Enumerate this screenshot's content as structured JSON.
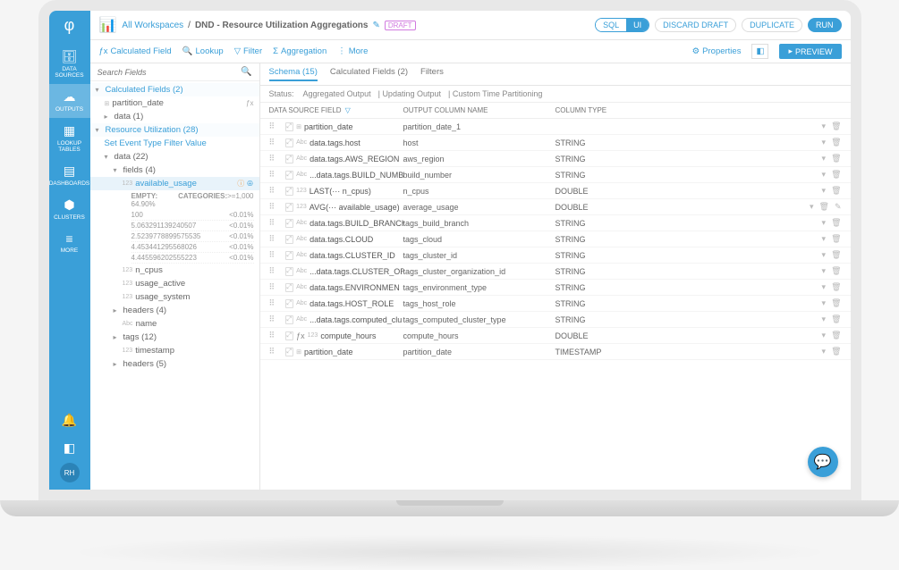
{
  "nav": {
    "items": [
      {
        "icon": "database",
        "label": "DATA SOURCES"
      },
      {
        "icon": "cloud",
        "label": "OUTPUTS",
        "active": true
      },
      {
        "icon": "table",
        "label": "LOOKUP TABLES"
      },
      {
        "icon": "dashboard",
        "label": "DASHBOARDS"
      },
      {
        "icon": "cluster",
        "label": "CLUSTERS"
      },
      {
        "icon": "more",
        "label": "MORE"
      }
    ],
    "avatar": "RH"
  },
  "header": {
    "breadcrumb": [
      "All Workspaces",
      "DND - Resource Utilization Aggregations"
    ],
    "draft": "DRAFT",
    "toggle": {
      "off": "SQL",
      "on": "UI"
    },
    "buttons": {
      "discard": "DISCARD DRAFT",
      "duplicate": "DUPLICATE",
      "run": "RUN"
    }
  },
  "toolbar": {
    "items": [
      {
        "icon": "fx",
        "label": "Calculated Field"
      },
      {
        "icon": "search",
        "label": "Lookup"
      },
      {
        "icon": "funnel",
        "label": "Filter"
      },
      {
        "icon": "sigma",
        "label": "Aggregation"
      },
      {
        "icon": "dots",
        "label": "More"
      }
    ],
    "right": {
      "properties": "Properties",
      "preview": "PREVIEW"
    }
  },
  "search": {
    "placeholder": "Search Fields"
  },
  "tree": {
    "calc_header": "Calculated Fields (2)",
    "calc_item": "partition_date",
    "data_header": "data (1)",
    "ru_header": "Resource Utilization (28)",
    "set_filter": "Set Event Type Filter Value",
    "data22": "data (22)",
    "fields": "fields (4)",
    "selected": "available_usage",
    "stats": {
      "empty_lbl": "EMPTY:",
      "empty": "64.90%",
      "cat_lbl": "CATEGORIES:",
      "cat": ">=1,000"
    },
    "samples": [
      {
        "v": "100",
        "p": "<0.01%"
      },
      {
        "v": "5.063291139240507",
        "p": "<0.01%"
      },
      {
        "v": "2.5239778899575535",
        "p": "<0.01%"
      },
      {
        "v": "4.453441295568026",
        "p": "<0.01%"
      },
      {
        "v": "4.445596202555223",
        "p": "<0.01%"
      }
    ],
    "rest": [
      {
        "t": "123",
        "n": "n_cpus"
      },
      {
        "t": "123",
        "n": "usage_active"
      },
      {
        "t": "123",
        "n": "usage_system"
      },
      {
        "t": "",
        "n": "headers (4)",
        "caret": true
      },
      {
        "t": "Abc",
        "n": "name"
      },
      {
        "t": "",
        "n": "tags (12)",
        "caret": true
      },
      {
        "t": "123",
        "n": "timestamp"
      },
      {
        "t": "",
        "n": "headers (5)",
        "caret": true
      }
    ]
  },
  "right": {
    "tabs": [
      {
        "l": "Schema (15)",
        "a": true
      },
      {
        "l": "Calculated Fields (2)"
      },
      {
        "l": "Filters"
      }
    ],
    "status": {
      "label": "Status:",
      "items": [
        "Aggregated Output",
        "Updating Output",
        "Custom Time Partitioning"
      ]
    },
    "cols": {
      "c1": "DATA SOURCE FIELD",
      "c2": "OUTPUT COLUMN NAME",
      "c3": "COLUMN TYPE"
    },
    "rows": [
      {
        "t": "date",
        "src": "partition_date",
        "out": "partition_date_1",
        "typ": ""
      },
      {
        "t": "Abc",
        "src": "data.tags.host",
        "out": "host",
        "typ": "STRING"
      },
      {
        "t": "Abc",
        "src": "data.tags.AWS_REGION",
        "out": "aws_region",
        "typ": "STRING"
      },
      {
        "t": "Abc",
        "src": "...data.tags.BUILD_NUMB",
        "out": "build_number",
        "typ": "STRING"
      },
      {
        "t": "123",
        "src": "LAST(··· n_cpus)",
        "out": "n_cpus",
        "typ": "DOUBLE"
      },
      {
        "t": "123",
        "src": "AVG(··· available_usage)",
        "out": "average_usage",
        "typ": "DOUBLE",
        "edit": true
      },
      {
        "t": "Abc",
        "src": "data.tags.BUILD_BRANCH",
        "out": "tags_build_branch",
        "typ": "STRING"
      },
      {
        "t": "Abc",
        "src": "data.tags.CLOUD",
        "out": "tags_cloud",
        "typ": "STRING"
      },
      {
        "t": "Abc",
        "src": "data.tags.CLUSTER_ID",
        "out": "tags_cluster_id",
        "typ": "STRING"
      },
      {
        "t": "Abc",
        "src": "...data.tags.CLUSTER_OR",
        "out": "tags_cluster_organization_id",
        "typ": "STRING"
      },
      {
        "t": "Abc",
        "src": "data.tags.ENVIRONMEN",
        "out": "tags_environment_type",
        "typ": "STRING"
      },
      {
        "t": "Abc",
        "src": "data.tags.HOST_ROLE",
        "out": "tags_host_role",
        "typ": "STRING"
      },
      {
        "t": "Abc",
        "src": "...data.tags.computed_clu",
        "out": "tags_computed_cluster_type",
        "typ": "STRING"
      },
      {
        "t": "123",
        "src": "compute_hours",
        "out": "compute_hours",
        "typ": "DOUBLE",
        "fx": true
      },
      {
        "t": "date",
        "src": "partition_date",
        "out": "partition_date",
        "typ": "TIMESTAMP"
      }
    ]
  }
}
